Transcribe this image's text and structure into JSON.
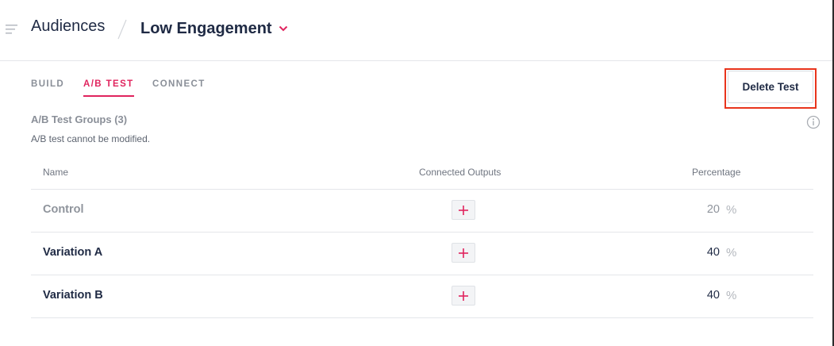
{
  "header": {
    "breadcrumb_root": "Audiences",
    "audience_name": "Low Engagement"
  },
  "tabs": [
    {
      "label": "BUILD",
      "active": false
    },
    {
      "label": "A/B TEST",
      "active": true
    },
    {
      "label": "CONNECT",
      "active": false
    }
  ],
  "actions": {
    "delete_label": "Delete Test"
  },
  "groups": {
    "title": "A/B Test Groups (3)",
    "note": "A/B test cannot be modified."
  },
  "table": {
    "columns": [
      "Name",
      "Connected Outputs",
      "Percentage"
    ],
    "rows": [
      {
        "name": "Control",
        "percentage": "20",
        "unit": "%"
      },
      {
        "name": "Variation A",
        "percentage": "40",
        "unit": "%"
      },
      {
        "name": "Variation B",
        "percentage": "40",
        "unit": "%"
      }
    ]
  },
  "colors": {
    "accent": "#e0245e",
    "highlight_box": "#e8341c",
    "text_dark": "#1f2a44",
    "text_muted": "#8a8f98"
  },
  "icons": {
    "menu": "menu-lines-icon",
    "dropdown": "chevron-down-icon",
    "info": "info-circle-icon",
    "add": "plus-icon"
  }
}
